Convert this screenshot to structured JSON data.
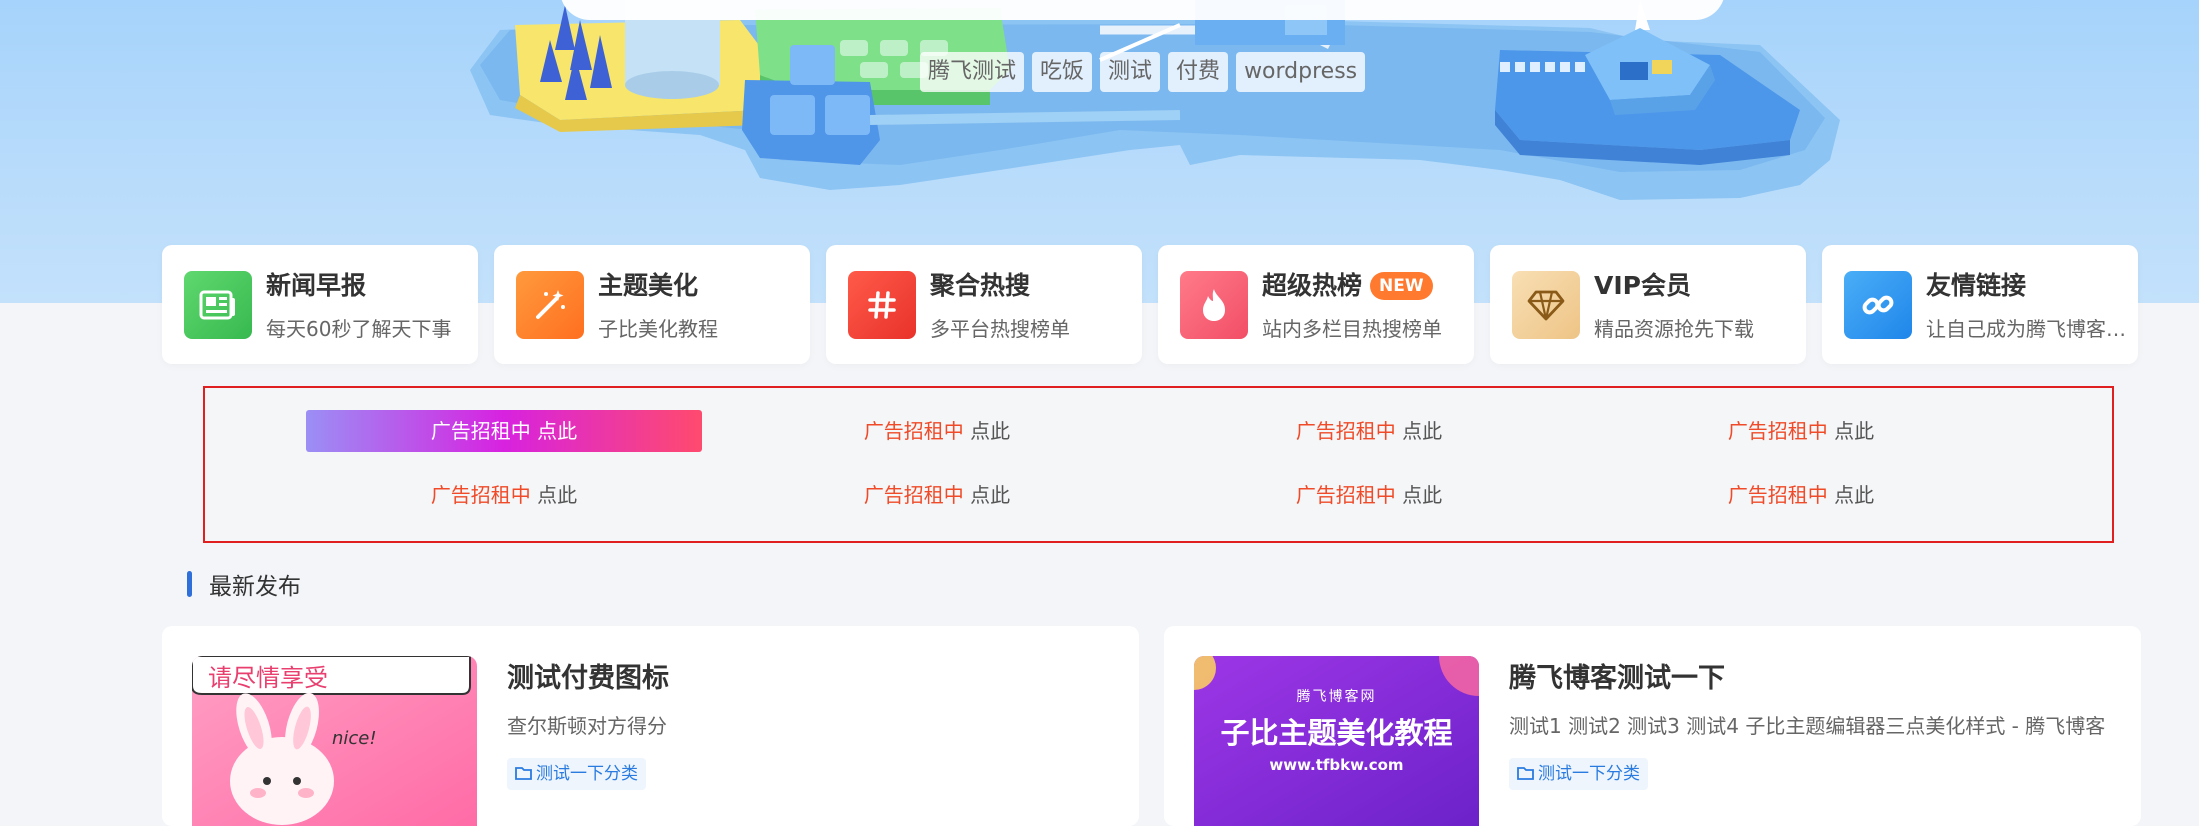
{
  "hero": {
    "hot_tags": [
      "腾飞测试",
      "吃饭",
      "测试",
      "付费",
      "wordpress"
    ]
  },
  "quick_links": [
    {
      "title": "新闻早报",
      "subtitle": "每天60秒了解天下事",
      "icon": "newspaper-icon",
      "color": "#3cc45f",
      "badge": ""
    },
    {
      "title": "主题美化",
      "subtitle": "子比美化教程",
      "icon": "magic-wand-icon",
      "color": "#ff7f2e",
      "badge": ""
    },
    {
      "title": "聚合热搜",
      "subtitle": "多平台热搜榜单",
      "icon": "hashtag-icon",
      "color": "#f44336",
      "badge": ""
    },
    {
      "title": "超级热榜",
      "subtitle": "站内多栏目热搜榜单",
      "icon": "fire-icon",
      "color": "#f5576c",
      "badge": "NEW"
    },
    {
      "title": "VIP会员",
      "subtitle": "精品资源抢先下载",
      "icon": "diamond-icon",
      "color": "#f2cf9b",
      "badge": ""
    },
    {
      "title": "友情链接",
      "subtitle": "让自己成为腾飞博客的一员",
      "icon": "link-icon",
      "color": "#2196f3",
      "badge": ""
    }
  ],
  "ads": {
    "red_text": "广告招租中",
    "dark_text": " 点此",
    "count": 8
  },
  "section": {
    "title": "最新发布"
  },
  "posts": [
    {
      "title": "测试付费图标",
      "excerpt": "查尔斯顿对方得分",
      "category": "测试一下分类",
      "thumb_text": "请尽情享受",
      "thumb_small": "nice!"
    },
    {
      "title": "腾飞博客测试一下",
      "excerpt": "测试1 测试2 测试3 测试4 子比主题编辑器三点美化样式 - 腾飞博客",
      "category": "测试一下分类",
      "thumb_small": "腾飞博客网",
      "thumb_text": "子比主题美化教程",
      "thumb_url": "www.tfbkw.com"
    }
  ],
  "colors": {
    "accent": "#2e6fd9",
    "ad_red": "#f04a28",
    "ad_border": "#e02020"
  }
}
